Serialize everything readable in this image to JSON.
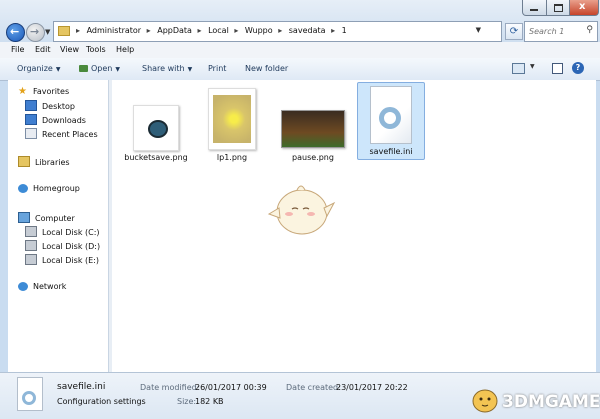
{
  "window": {
    "breadcrumbs": [
      "Administrator",
      "AppData",
      "Local",
      "Wuppo",
      "savedata",
      "1"
    ],
    "breadcrumb_separator": "▸",
    "search_placeholder": "Search 1",
    "close_glyph": "x"
  },
  "menubar": {
    "items": [
      "File",
      "Edit",
      "View",
      "Tools",
      "Help"
    ]
  },
  "toolbar": {
    "organize": "Organize",
    "open": "Open",
    "share_with": "Share with",
    "print": "Print",
    "new_folder": "New folder"
  },
  "sidebar": {
    "favorites": "Favorites",
    "desktop": "Desktop",
    "downloads": "Downloads",
    "recent_places": "Recent Places",
    "libraries": "Libraries",
    "homegroup": "Homegroup",
    "computer": "Computer",
    "disk_c": "Local Disk (C:)",
    "disk_d": "Local Disk (D:)",
    "disk_e": "Local Disk (E:)",
    "network": "Network"
  },
  "files": [
    {
      "name": "bucketsave.png",
      "icon": "png-thumbnail"
    },
    {
      "name": "lp1.png",
      "icon": "png-thumbnail"
    },
    {
      "name": "pause.png",
      "icon": "png-thumbnail"
    },
    {
      "name": "savefile.ini",
      "icon": "settings-file-icon",
      "selected": true
    }
  ],
  "details": {
    "name": "savefile.ini",
    "type": "Configuration settings",
    "modified_label": "Date modified:",
    "modified_value": "26/01/2017 00:39",
    "size_label": "Size:",
    "size_value": "182 KB",
    "created_label": "Date created:",
    "created_value": "23/01/2017 20:22"
  },
  "watermark": {
    "text": "3DMGAME"
  },
  "colors": {
    "selection": "#cde6fb",
    "accent": "#1b58b8",
    "close": "#c6442a"
  }
}
